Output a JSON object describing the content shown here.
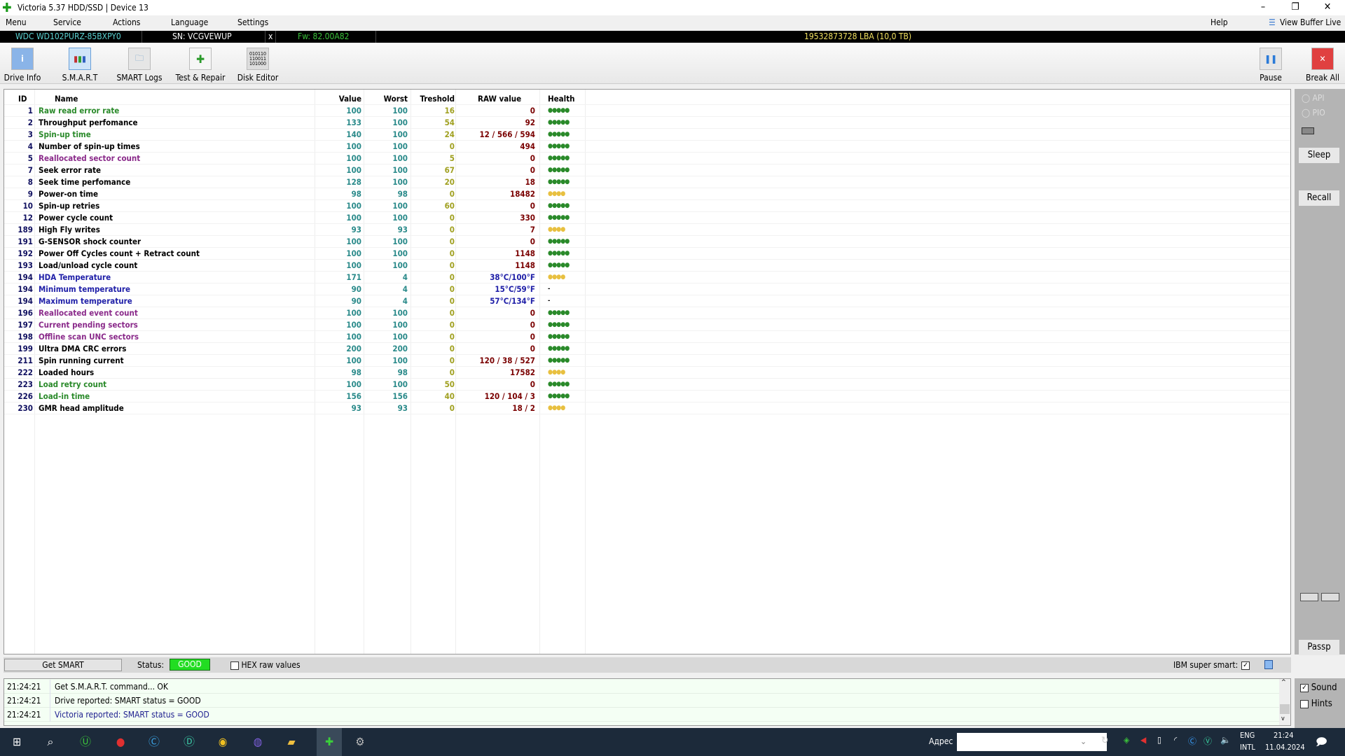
{
  "window": {
    "title": "Victoria 5.37 HDD/SSD | Device 13",
    "minimize": "–",
    "restore": "❐",
    "close": "✕"
  },
  "menu": {
    "items": [
      "Menu",
      "Service",
      "Actions",
      "Language",
      "Settings"
    ],
    "help": "Help",
    "view_buffer": "View Buffer Live"
  },
  "drive": {
    "model": "WDC WD102PURZ-85BXPY0",
    "serial": "SN: VCGVEWUP",
    "x": "x",
    "firmware": "Fw: 82.00A82",
    "capacity": "19532873728 LBA (10,0 TB)"
  },
  "toolbar": {
    "buttons": [
      {
        "label": "Drive Info",
        "icon": "info-icon"
      },
      {
        "label": "S.M.A.R.T",
        "icon": "chart-icon"
      },
      {
        "label": "SMART Logs",
        "icon": "folder-icon"
      },
      {
        "label": "Test & Repair",
        "icon": "plus-icon"
      },
      {
        "label": "Disk Editor",
        "icon": "binary-icon"
      }
    ],
    "pause": "Pause",
    "break_all": "Break All"
  },
  "table": {
    "headers": [
      "ID",
      "Name",
      "Value",
      "Worst",
      "Treshold",
      "RAW value",
      "Health"
    ],
    "rows": [
      {
        "id": "1",
        "name": "Raw read error rate",
        "value": "100",
        "worst": "100",
        "thr": "16",
        "raw": "0",
        "health": "●●●●●",
        "nc": "green",
        "hc": "green",
        "rc": "red"
      },
      {
        "id": "2",
        "name": "Throughput perfomance",
        "value": "133",
        "worst": "100",
        "thr": "54",
        "raw": "92",
        "health": "●●●●●",
        "nc": "black",
        "hc": "green",
        "rc": "red"
      },
      {
        "id": "3",
        "name": "Spin-up time",
        "value": "140",
        "worst": "100",
        "thr": "24",
        "raw": "12 / 566 / 594",
        "health": "●●●●●",
        "nc": "green",
        "hc": "green",
        "rc": "red"
      },
      {
        "id": "4",
        "name": "Number of spin-up times",
        "value": "100",
        "worst": "100",
        "thr": "0",
        "raw": "494",
        "health": "●●●●●",
        "nc": "black",
        "hc": "green",
        "rc": "red"
      },
      {
        "id": "5",
        "name": "Reallocated sector count",
        "value": "100",
        "worst": "100",
        "thr": "5",
        "raw": "0",
        "health": "●●●●●",
        "nc": "purple",
        "hc": "green",
        "rc": "red"
      },
      {
        "id": "7",
        "name": "Seek error rate",
        "value": "100",
        "worst": "100",
        "thr": "67",
        "raw": "0",
        "health": "●●●●●",
        "nc": "black",
        "hc": "green",
        "rc": "red"
      },
      {
        "id": "8",
        "name": "Seek time perfomance",
        "value": "128",
        "worst": "100",
        "thr": "20",
        "raw": "18",
        "health": "●●●●●",
        "nc": "black",
        "hc": "green",
        "rc": "red"
      },
      {
        "id": "9",
        "name": "Power-on time",
        "value": "98",
        "worst": "98",
        "thr": "0",
        "raw": "18482",
        "health": "●●●●",
        "nc": "black",
        "hc": "yellow",
        "rc": "red"
      },
      {
        "id": "10",
        "name": "Spin-up retries",
        "value": "100",
        "worst": "100",
        "thr": "60",
        "raw": "0",
        "health": "●●●●●",
        "nc": "black",
        "hc": "green",
        "rc": "red"
      },
      {
        "id": "12",
        "name": "Power cycle count",
        "value": "100",
        "worst": "100",
        "thr": "0",
        "raw": "330",
        "health": "●●●●●",
        "nc": "black",
        "hc": "green",
        "rc": "red"
      },
      {
        "id": "189",
        "name": "High Fly writes",
        "value": "93",
        "worst": "93",
        "thr": "0",
        "raw": "7",
        "health": "●●●●",
        "nc": "black",
        "hc": "yellow",
        "rc": "red"
      },
      {
        "id": "191",
        "name": "G-SENSOR shock counter",
        "value": "100",
        "worst": "100",
        "thr": "0",
        "raw": "0",
        "health": "●●●●●",
        "nc": "black",
        "hc": "green",
        "rc": "red"
      },
      {
        "id": "192",
        "name": "Power Off Cycles count + Retract count",
        "value": "100",
        "worst": "100",
        "thr": "0",
        "raw": "1148",
        "health": "●●●●●",
        "nc": "black",
        "hc": "green",
        "rc": "red"
      },
      {
        "id": "193",
        "name": "Load/unload cycle count",
        "value": "100",
        "worst": "100",
        "thr": "0",
        "raw": "1148",
        "health": "●●●●●",
        "nc": "black",
        "hc": "green",
        "rc": "red"
      },
      {
        "id": "194",
        "name": "HDA Temperature",
        "value": "171",
        "worst": "4",
        "thr": "0",
        "raw": "38°C/100°F",
        "health": "●●●●",
        "nc": "blue",
        "hc": "yellow",
        "rc": "blue"
      },
      {
        "id": "194",
        "name": "Minimum temperature",
        "value": "90",
        "worst": "4",
        "thr": "0",
        "raw": "15°C/59°F",
        "health": "-",
        "nc": "blue",
        "hc": "black",
        "rc": "blue"
      },
      {
        "id": "194",
        "name": "Maximum temperature",
        "value": "90",
        "worst": "4",
        "thr": "0",
        "raw": "57°C/134°F",
        "health": "-",
        "nc": "blue",
        "hc": "black",
        "rc": "blue"
      },
      {
        "id": "196",
        "name": "Reallocated event count",
        "value": "100",
        "worst": "100",
        "thr": "0",
        "raw": "0",
        "health": "●●●●●",
        "nc": "purple",
        "hc": "green",
        "rc": "red"
      },
      {
        "id": "197",
        "name": "Current pending sectors",
        "value": "100",
        "worst": "100",
        "thr": "0",
        "raw": "0",
        "health": "●●●●●",
        "nc": "purple",
        "hc": "green",
        "rc": "red"
      },
      {
        "id": "198",
        "name": "Offline scan UNC sectors",
        "value": "100",
        "worst": "100",
        "thr": "0",
        "raw": "0",
        "health": "●●●●●",
        "nc": "purple",
        "hc": "green",
        "rc": "red"
      },
      {
        "id": "199",
        "name": "Ultra DMA CRC errors",
        "value": "200",
        "worst": "200",
        "thr": "0",
        "raw": "0",
        "health": "●●●●●",
        "nc": "black",
        "hc": "green",
        "rc": "red"
      },
      {
        "id": "211",
        "name": "Spin running current",
        "value": "100",
        "worst": "100",
        "thr": "0",
        "raw": "120 / 38 / 527",
        "health": "●●●●●",
        "nc": "black",
        "hc": "green",
        "rc": "red"
      },
      {
        "id": "222",
        "name": "Loaded hours",
        "value": "98",
        "worst": "98",
        "thr": "0",
        "raw": "17582",
        "health": "●●●●",
        "nc": "black",
        "hc": "yellow",
        "rc": "red"
      },
      {
        "id": "223",
        "name": "Load retry count",
        "value": "100",
        "worst": "100",
        "thr": "50",
        "raw": "0",
        "health": "●●●●●",
        "nc": "green",
        "hc": "green",
        "rc": "red"
      },
      {
        "id": "226",
        "name": "Load-in time",
        "value": "156",
        "worst": "156",
        "thr": "40",
        "raw": "120 / 104 / 3",
        "health": "●●●●●",
        "nc": "green",
        "hc": "green",
        "rc": "red"
      },
      {
        "id": "230",
        "name": "GMR head amplitude",
        "value": "93",
        "worst": "93",
        "thr": "0",
        "raw": "18 / 2",
        "health": "●●●●",
        "nc": "black",
        "hc": "yellow",
        "rc": "red"
      }
    ]
  },
  "colors": {
    "green": "#2a8a2a",
    "purple": "#8a2a8a",
    "blue": "#2020a8",
    "black": "#000000",
    "red": "#7a0000",
    "yellow": "#e8c040",
    "value": "#2a8a8a",
    "threshold": "#a0a020",
    "status_good": "#22dd22"
  },
  "right_panel": {
    "api": "API",
    "pio": "PIO",
    "sleep": "Sleep",
    "recall": "Recall",
    "passp": "Passp",
    "sound": "Sound",
    "sound_checked": true,
    "hints": "Hints",
    "hints_checked": false
  },
  "bottom": {
    "get_smart": "Get SMART",
    "status_label": "Status:",
    "status": "GOOD",
    "hex_raw": "HEX raw values",
    "hex_checked": false,
    "ibm_super_smart": "IBM super smart:",
    "ibm_checked": true
  },
  "log": [
    {
      "time": "21:24:21",
      "text": "Get S.M.A.R.T. command... OK",
      "color": "#000000"
    },
    {
      "time": "21:24:21",
      "text": "Drive reported: SMART status = GOOD",
      "color": "#000000"
    },
    {
      "time": "21:24:21",
      "text": "Victoria reported: SMART status = GOOD",
      "color": "#202090"
    }
  ],
  "taskbar": {
    "address_label": "Адрес",
    "lang1": "ENG",
    "lang2": "INTL",
    "time": "21:24",
    "date": "11.04.2024"
  }
}
